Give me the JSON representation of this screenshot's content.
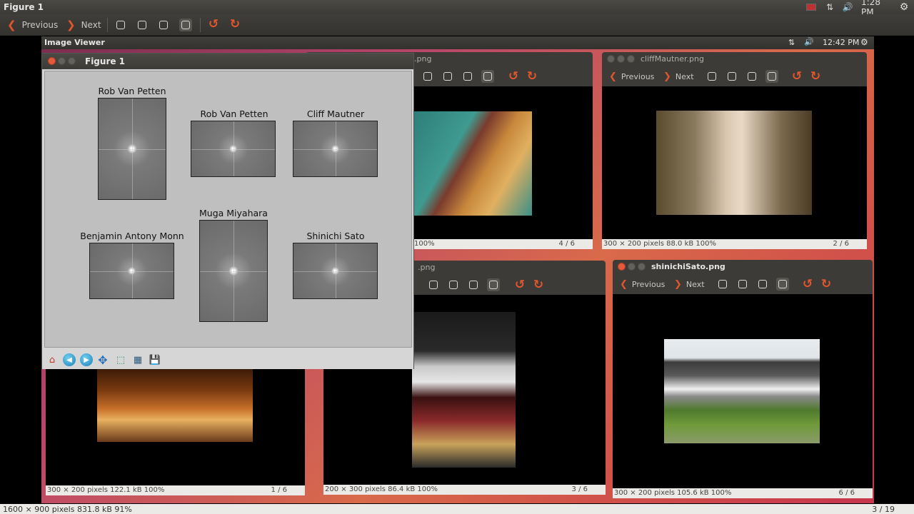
{
  "outer": {
    "title": "Figure 1",
    "clock": "1:28 PM",
    "toolbar": {
      "previous": "Previous",
      "next": "Next"
    },
    "status_left": "1600 × 900 pixels  831.8 kB   91%",
    "status_right": "3 / 19"
  },
  "inner_panel": {
    "title": "Image Viewer",
    "clock": "12:42 PM"
  },
  "viewers": [
    {
      "title": ".png",
      "status_left": "100%",
      "status_right": "4 / 6"
    },
    {
      "title": "cliffMautner.png",
      "previous": "Previous",
      "next": "Next",
      "status_left": "300 × 200 pixels  88.0 kB   100%",
      "status_right": "2 / 6"
    },
    {
      "title": ".png",
      "status_left": "200 × 300 pixels  86.4 kB   100%",
      "status_right": "3 / 6"
    },
    {
      "title": "shinichiSato.png",
      "previous": "Previous",
      "next": "Next",
      "status_left": "300 × 200 pixels  105.6 kB   100%",
      "status_right": "6 / 6"
    },
    {
      "status_left": "300 × 200 pixels  122.1 kB   100%",
      "status_right": "1 / 6"
    }
  ],
  "figure": {
    "title": "Figure 1",
    "subplots": [
      {
        "title": "Rob Van Petten"
      },
      {
        "title": "Rob Van Petten"
      },
      {
        "title": "Cliff Mautner"
      },
      {
        "title": "Benjamin Antony Monn"
      },
      {
        "title": "Muga Miyahara"
      },
      {
        "title": "Shinichi Sato"
      }
    ]
  },
  "colors": {
    "accent": "#e2562d",
    "panel": "#3c3b37",
    "status_bg": "#eceae6"
  }
}
